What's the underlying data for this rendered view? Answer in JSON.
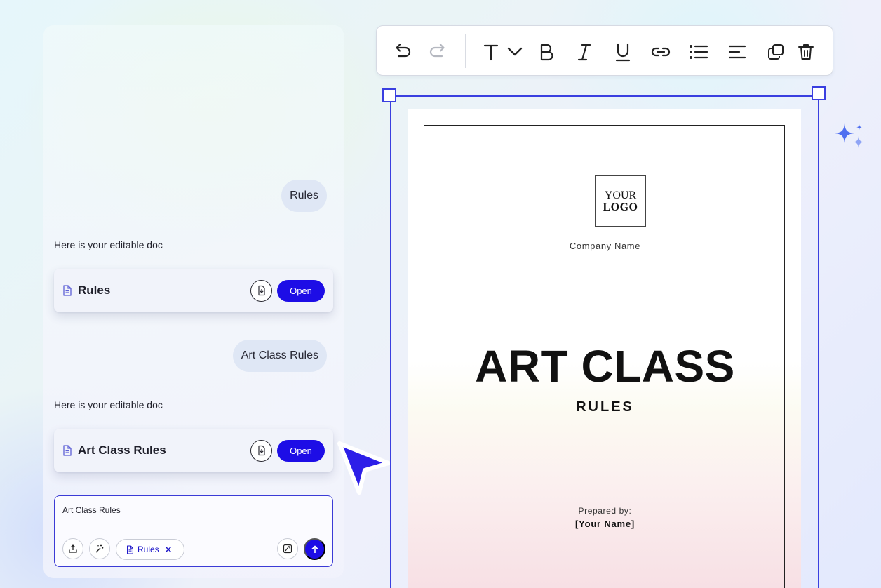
{
  "chat": {
    "messages": [
      {
        "role": "user",
        "text": "Rules"
      },
      {
        "role": "assistant",
        "text": "Here is your editable doc",
        "doc_title": "Rules",
        "open_label": "Open"
      },
      {
        "role": "user",
        "text": "Art Class Rules"
      },
      {
        "role": "assistant",
        "text": "Here is your editable doc",
        "doc_title": "Art Class Rules",
        "open_label": "Open"
      }
    ],
    "composer": {
      "value": "Art Class Rules",
      "attachment_chip": "Rules"
    }
  },
  "toolbar": {
    "icons": [
      "undo-icon",
      "redo-icon",
      "text-style-icon",
      "chevron-down-icon",
      "bold-icon",
      "italic-icon",
      "underline-icon",
      "link-icon",
      "bullet-list-icon",
      "align-left-icon",
      "duplicate-icon",
      "delete-icon"
    ]
  },
  "document": {
    "logo_line1": "YOUR",
    "logo_line2": "LOGO",
    "company_name": "Company Name",
    "title": "ART CLASS",
    "subtitle": "RULES",
    "prepared_by_label": "Prepared by:",
    "prepared_by_name": "[Your Name]"
  },
  "colors": {
    "accent": "#1d0de6",
    "selection": "#3a3fe0",
    "bubble": "#dfe7f5",
    "sparkle": "#5a7cf0"
  }
}
